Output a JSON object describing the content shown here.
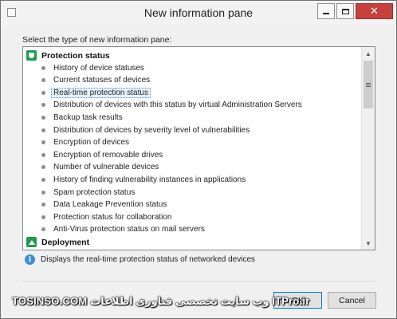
{
  "window": {
    "title": "New information pane",
    "icon": "window-icon",
    "controls": {
      "minimize": "",
      "maximize": "",
      "close": "✕"
    }
  },
  "prompt": "Select the type of new information pane:",
  "list": {
    "groups": [
      {
        "label": "Protection status",
        "icon": "shield-icon",
        "items": [
          "History of device statuses",
          "Current statuses of devices",
          "Real-time protection status",
          "Distribution of devices with this status by virtual Administration Servers",
          "Backup task results",
          "Distribution of devices by severity level of vulnerabilities",
          "Encryption of devices",
          "Encryption of removable drives",
          "Number of vulnerable devices",
          "History of finding vulnerability instances in applications",
          "Spam protection status",
          "Data Leakage Prevention status",
          "Protection status for collaboration",
          "Anti-Virus protection status on mail servers"
        ]
      },
      {
        "label": "Deployment",
        "icon": "deployment-icon",
        "items": []
      }
    ],
    "selected": "Real-time protection status",
    "scroll_arrows": {
      "up": "▲",
      "down": "▼"
    }
  },
  "description": "Displays the real-time protection status of networked devices",
  "info_icon_glyph": "i",
  "buttons": {
    "ok": "OK",
    "cancel": "Cancel"
  },
  "watermark": "TOSINSO.COM و‌ب سایت تخصصی فناوری اطلاعات ITPro.ir",
  "colors": {
    "close": "#c7413c",
    "group_icon": "#1f9b4e",
    "info": "#3c8fd6",
    "selection": "#e5f1fb"
  }
}
